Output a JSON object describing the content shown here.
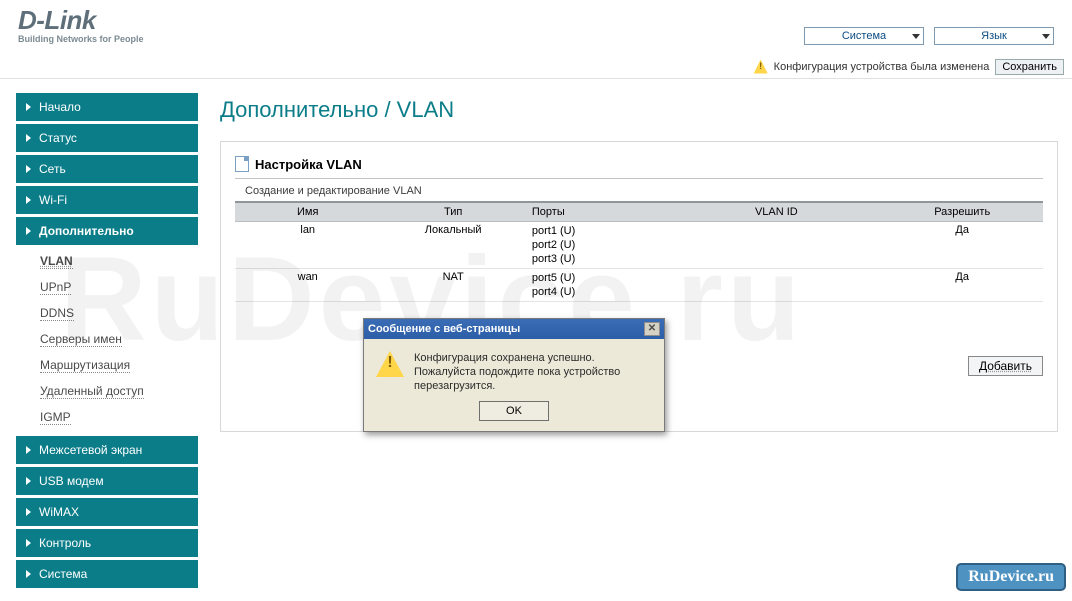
{
  "header": {
    "logo_main": "D-Link",
    "logo_tag": "Building Networks for People",
    "dd_system": "Система",
    "dd_lang": "Язык"
  },
  "status": {
    "text": "Конфигурация устройства была изменена",
    "save_btn": "Сохранить"
  },
  "sidebar": {
    "items": [
      {
        "label": "Начало"
      },
      {
        "label": "Статус"
      },
      {
        "label": "Сеть"
      },
      {
        "label": "Wi-Fi"
      },
      {
        "label": "Дополнительно",
        "active": true
      },
      {
        "label": "Межсетевой экран"
      },
      {
        "label": "USB модем"
      },
      {
        "label": "WiMAX"
      },
      {
        "label": "Контроль"
      },
      {
        "label": "Система"
      }
    ],
    "sub": [
      {
        "label": "VLAN",
        "active": true
      },
      {
        "label": "UPnP"
      },
      {
        "label": "DDNS"
      },
      {
        "label": "Серверы имен"
      },
      {
        "label": "Маршрутизация"
      },
      {
        "label": "Удаленный доступ"
      },
      {
        "label": "IGMP"
      }
    ]
  },
  "page": {
    "title": "Дополнительно / VLAN",
    "panel_title": "Настройка VLAN",
    "panel_sub": "Создание и редактирование VLAN",
    "add_btn": "Добавить",
    "table": {
      "headers": {
        "name": "Имя",
        "type": "Тип",
        "ports": "Порты",
        "vlanid": "VLAN ID",
        "allow": "Разрешить"
      },
      "rows": [
        {
          "name": "lan",
          "type": "Локальный",
          "ports": [
            "port1 (U)",
            "port2 (U)",
            "port3 (U)"
          ],
          "vlanid": "",
          "allow": "Да"
        },
        {
          "name": "wan",
          "type": "NAT",
          "ports": [
            "port5 (U)",
            "port4 (U)"
          ],
          "vlanid": "",
          "allow": "Да"
        }
      ]
    }
  },
  "dialog": {
    "title": "Сообщение с веб-страницы",
    "line1": "Конфигурация сохранена успешно.",
    "line2": "Пожалуйста подождите пока устройство перезагрузится.",
    "ok": "OK"
  },
  "watermark_big": "RuDevice.ru",
  "watermark_badge": "RuDevice.ru"
}
